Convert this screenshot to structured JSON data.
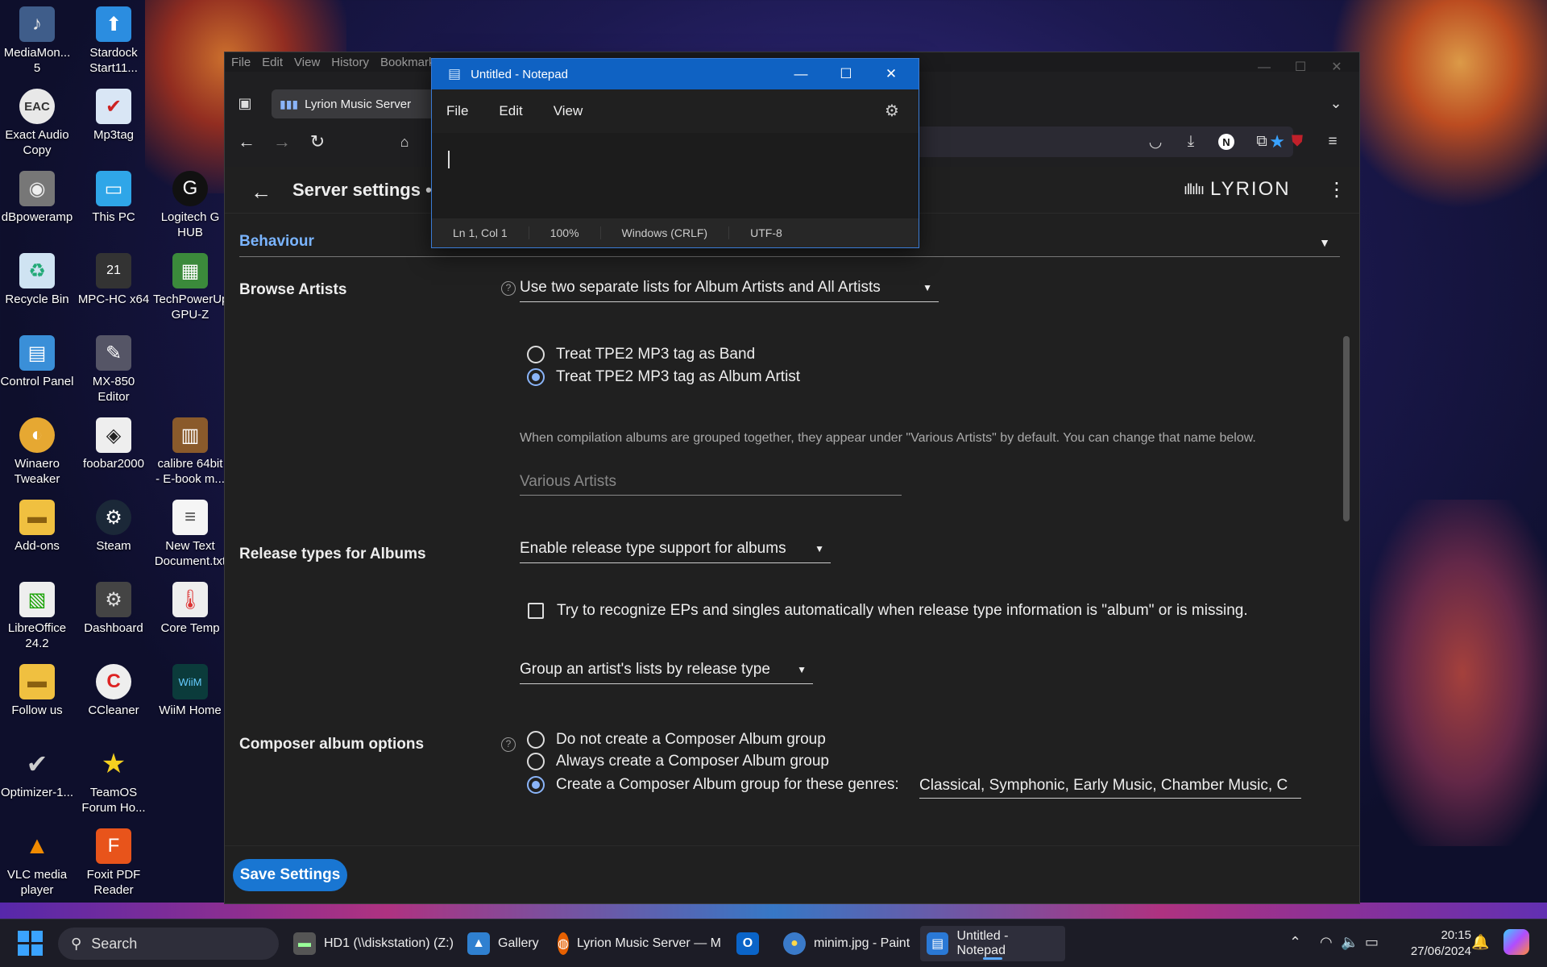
{
  "desktop": {
    "icons": [
      {
        "label": "MediaMon...\n5",
        "icon": "mediamonkey-icon"
      },
      {
        "label": "Stardock\nStart11...",
        "icon": "start11-icon"
      },
      {
        "label": "Exact Audio\nCopy",
        "icon": "eac-icon"
      },
      {
        "label": "Mp3tag",
        "icon": "mp3tag-icon"
      },
      {
        "label": "dBpoweramp",
        "icon": "dbpoweramp-icon"
      },
      {
        "label": "This PC",
        "icon": "monitor-icon"
      },
      {
        "label": "Logitech G\nHUB",
        "icon": "logitech-icon"
      },
      {
        "label": "Recycle Bin",
        "icon": "recycle-bin-icon"
      },
      {
        "label": "MPC-HC x64",
        "icon": "mpc-icon"
      },
      {
        "label": "TechPowerUp\nGPU-Z",
        "icon": "gpuz-icon"
      },
      {
        "label": "Control Panel",
        "icon": "control-panel-icon"
      },
      {
        "label": "MX-850\nEditor",
        "icon": "mx850-icon"
      },
      {
        "label": "Winaero\nTweaker",
        "icon": "winaero-icon"
      },
      {
        "label": "foobar2000",
        "icon": "foobar-icon"
      },
      {
        "label": "calibre 64bit\n- E-book m...",
        "icon": "calibre-icon"
      },
      {
        "label": "Add-ons",
        "icon": "folder-icon"
      },
      {
        "label": "Steam",
        "icon": "steam-icon"
      },
      {
        "label": "New Text\nDocument.txt",
        "icon": "text-file-icon"
      },
      {
        "label": "LibreOffice\n24.2",
        "icon": "libreoffice-icon"
      },
      {
        "label": "Dashboard",
        "icon": "dashboard-icon"
      },
      {
        "label": "Core Temp",
        "icon": "coretemp-icon"
      },
      {
        "label": "Follow us",
        "icon": "folder-icon"
      },
      {
        "label": "CCleaner",
        "icon": "ccleaner-icon"
      },
      {
        "label": "WiiM Home",
        "icon": "wiim-icon"
      },
      {
        "label": "Optimizer-1...",
        "icon": "checkmark-icon"
      },
      {
        "label": "TeamOS\nForum Ho...",
        "icon": "star-icon"
      },
      {
        "label": "VLC media\nplayer",
        "icon": "vlc-icon"
      },
      {
        "label": "Foxit PDF\nReader",
        "icon": "foxit-icon"
      }
    ]
  },
  "browser": {
    "menu": [
      "File",
      "Edit",
      "View",
      "History",
      "Bookmarks"
    ],
    "tab_title": "Lyrion Music Server",
    "colors": {
      "accent": "#7ab4ff",
      "save": "#1976d2",
      "radio": "#8ab4f8"
    }
  },
  "page": {
    "title": "Server settings •",
    "brand": "LYRION",
    "section": "Behaviour",
    "browse_artists": {
      "label": "Browse Artists",
      "select": "Use two separate lists for Album Artists and All Artists",
      "radio_band": "Treat TPE2 MP3 tag as Band",
      "radio_album_artist": "Treat TPE2 MP3 tag as Album Artist",
      "help": "When compilation albums are grouped together, they appear under \"Various Artists\" by default. You can change that name below.",
      "various_placeholder": "Various Artists"
    },
    "release_types": {
      "label": "Release types for Albums",
      "select": "Enable release type support for albums",
      "checkbox": "Try to recognize EPs and singles automatically when release type information is \"album\" or is missing.",
      "group_select": "Group an artist's lists by release type"
    },
    "composer": {
      "label": "Composer album options",
      "opt1": "Do not create a Composer Album group",
      "opt2": "Always create a Composer Album group",
      "opt3": "Create a Composer Album group for these genres:",
      "genres": "Classical, Symphonic, Early Music, Chamber Music, C"
    },
    "save_label": "Save Settings"
  },
  "notepad": {
    "title": "Untitled - Notepad",
    "menu": [
      "File",
      "Edit",
      "View"
    ],
    "status": [
      "Ln 1, Col 1",
      "100%",
      "Windows (CRLF)",
      "UTF-8"
    ]
  },
  "taskbar": {
    "search": "Search",
    "items": [
      {
        "label": "HD1 (\\\\diskstation) (Z:)",
        "icon": "drive-icon"
      },
      {
        "label": "Gallery",
        "icon": "gallery-icon"
      },
      {
        "label": "Lyrion Music Server — M",
        "icon": "firefox-icon"
      },
      {
        "label": "",
        "icon": "outlook-icon"
      },
      {
        "label": "minim.jpg - Paint",
        "icon": "paint-icon"
      },
      {
        "label": "Untitled - Notepad",
        "icon": "notepad-icon"
      }
    ],
    "time": "20:15",
    "date": "27/06/2024"
  }
}
